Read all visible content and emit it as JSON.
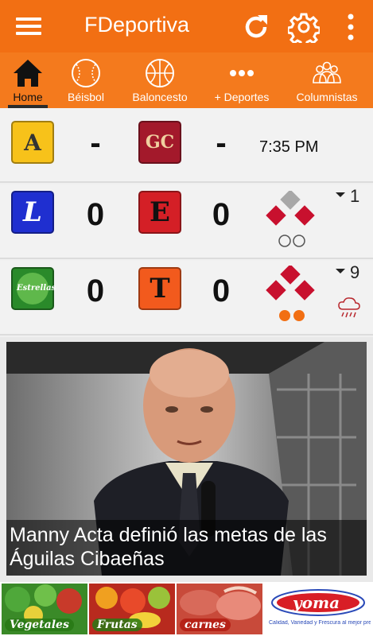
{
  "app": {
    "title": "FDeportiva"
  },
  "tabs": [
    {
      "label": "Home",
      "icon": "home-icon",
      "active": true
    },
    {
      "label": "Béisbol",
      "icon": "baseball-icon"
    },
    {
      "label": "Baloncesto",
      "icon": "basketball-icon"
    },
    {
      "label": "+ Deportes",
      "icon": "more-dots-icon"
    },
    {
      "label": "Columnistas",
      "icon": "people-icon"
    }
  ],
  "games": [
    {
      "away_score": "-",
      "home_score": "-",
      "time": "7:35 PM",
      "away_logo": "A",
      "home_logo": "GC"
    },
    {
      "away_score": "0",
      "home_score": "0",
      "inning": "1",
      "away_logo": "L",
      "home_logo": "E"
    },
    {
      "away_score": "0",
      "home_score": "0",
      "inning": "9",
      "away_logo": "Estrellas",
      "home_logo": "T"
    }
  ],
  "news": {
    "headline": "Manny Acta definió las metas de las Águilas Cibaeñas"
  },
  "ad": {
    "labels": [
      "Vegetales",
      "Frutas",
      "carnes"
    ],
    "brand": "yoma",
    "tagline": "Calidad, Variedad y Frescura al mejor precio"
  },
  "colors": {
    "appbar": "#f26f13",
    "tabs": "#f47a1d",
    "base_red": "#c8102e",
    "base_gray": "#9a9a9a",
    "out_orange": "#f26f13"
  }
}
